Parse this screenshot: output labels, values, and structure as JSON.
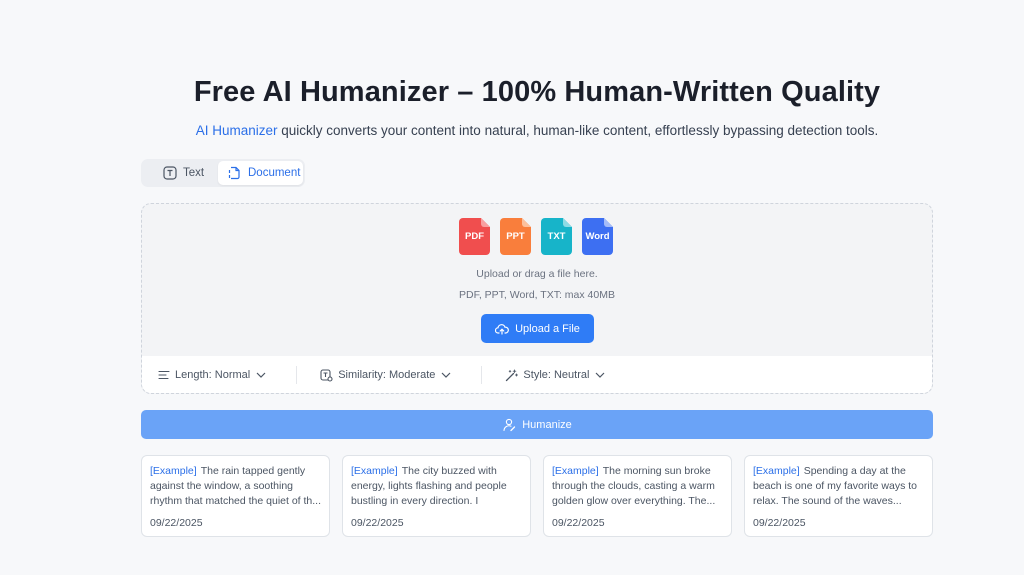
{
  "header": {
    "title": "Free AI Humanizer – 100% Human-Written Quality",
    "subtitle_highlight": "AI Humanizer",
    "subtitle_rest": " quickly converts your content into natural, human-like content, effortlessly bypassing detection tools."
  },
  "tabs": [
    {
      "label": "Text",
      "icon": "text-icon",
      "active": false
    },
    {
      "label": "Document",
      "icon": "document-icon",
      "active": true
    }
  ],
  "upload": {
    "file_types": [
      {
        "label": "PDF",
        "color": "#f04e4e"
      },
      {
        "label": "PPT",
        "color": "#f97e3c"
      },
      {
        "label": "TXT",
        "color": "#17b4c9"
      },
      {
        "label": "Word",
        "color": "#3d6ff2"
      }
    ],
    "prompt": "Upload or drag a file here.",
    "limits": "PDF, PPT, Word, TXT: max 40MB",
    "button_label": "Upload a File"
  },
  "options": [
    {
      "label": "Length: Normal",
      "icon": "length-lines-icon"
    },
    {
      "label": "Similarity: Moderate",
      "icon": "similarity-icon"
    },
    {
      "label": "Style: Neutral",
      "icon": "magic-wand-icon"
    }
  ],
  "humanize_label": "Humanize",
  "examples": [
    {
      "tag": "[Example]",
      "text": "The rain tapped gently against the window, a soothing rhythm that matched the quiet of th...",
      "date": "09/22/2025"
    },
    {
      "tag": "[Example]",
      "text": "The city buzzed with energy, lights flashing and people bustling in every direction. I weaved...",
      "date": "09/22/2025"
    },
    {
      "tag": "[Example]",
      "text": "The morning sun broke through the clouds, casting a warm golden glow over everything. The...",
      "date": "09/22/2025"
    },
    {
      "tag": "[Example]",
      "text": "Spending a day at the beach is one of my favorite ways to relax. The sound of the waves...",
      "date": "09/22/2025"
    }
  ],
  "colors": {
    "accent": "#2f7cf6",
    "accent_light": "#6aa3f7",
    "link": "#2b6fe8"
  }
}
